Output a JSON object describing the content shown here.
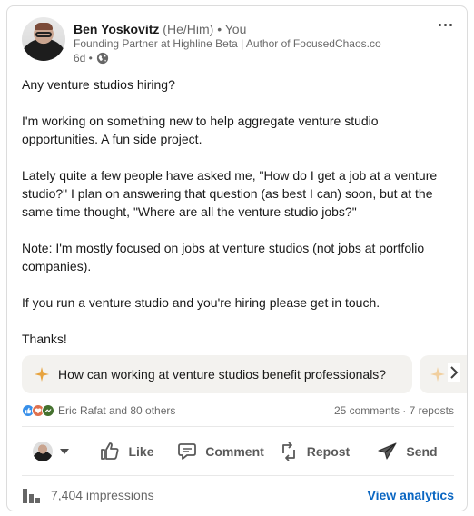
{
  "author": {
    "name": "Ben Yoskovitz",
    "pronouns": "(He/Him)",
    "degree": "• You",
    "headline": "Founding Partner at Highline Beta | Author of FocusedChaos.co",
    "time": "6d •"
  },
  "post": {
    "paragraphs": [
      "Any venture studios hiring?",
      "I'm working on something new to help aggregate venture studio opportunities. A fun side project.",
      "Lately quite a few people have asked me, \"How do I get a job at a venture studio?\" I plan on answering that question (as best I can) soon, but at the same time thought, \"Where are all the venture studio jobs?\"",
      "Note: I'm mostly focused on jobs at venture studios (not jobs at portfolio companies).",
      "If you run a venture studio and you're hiring please get in touch.",
      "Thanks!"
    ]
  },
  "prompt": {
    "text": "How can working at venture studios benefit professionals?"
  },
  "social": {
    "reactors": "Eric Rafat and 80 others",
    "comments_reposts": "25 comments · 7 reposts"
  },
  "actions": {
    "like": "Like",
    "comment": "Comment",
    "repost": "Repost",
    "send": "Send"
  },
  "footer": {
    "impressions": "7,404 impressions",
    "analytics": "View analytics"
  },
  "colors": {
    "link": "#0a66c2",
    "sparkle": "#e7a33e",
    "like_reaction": "#378fe9",
    "love_reaction": "#df704d",
    "support_reaction": "#44712e"
  }
}
